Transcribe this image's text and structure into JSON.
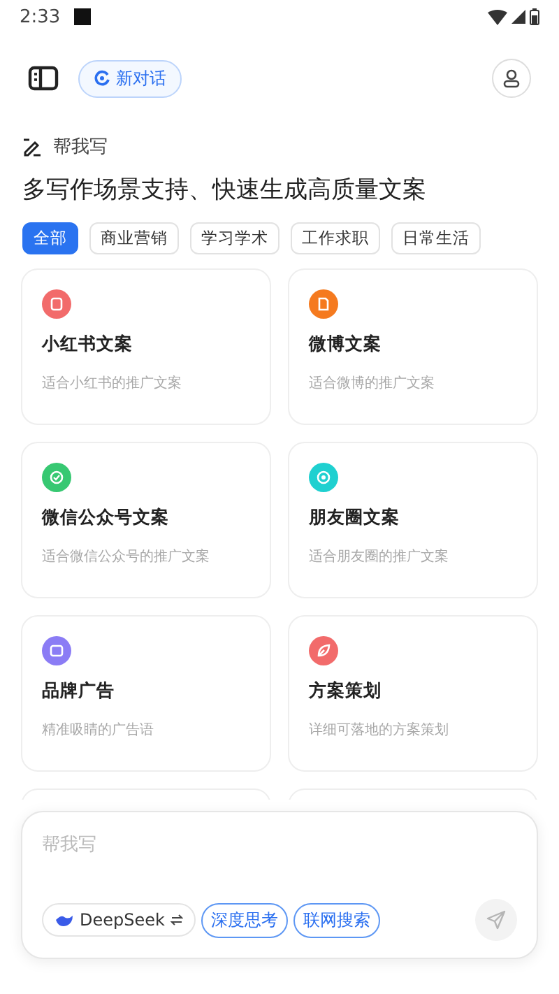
{
  "status_bar": {
    "time": "2:33"
  },
  "header": {
    "new_chat": "新对话"
  },
  "section": {
    "label": "帮我写",
    "headline": "多写作场景支持、快速生成高质量文案"
  },
  "categories": [
    {
      "label": "全部",
      "selected": true
    },
    {
      "label": "商业营销",
      "selected": false
    },
    {
      "label": "学习学术",
      "selected": false
    },
    {
      "label": "工作求职",
      "selected": false
    },
    {
      "label": "日常生活",
      "selected": false
    }
  ],
  "cards": [
    {
      "title": "小红书文案",
      "subtitle": "适合小红书的推广文案",
      "color": "#f26b6b"
    },
    {
      "title": "微博文案",
      "subtitle": "适合微博的推广文案",
      "color": "#f57a1f"
    },
    {
      "title": "微信公众号文案",
      "subtitle": "适合微信公众号的推广文案",
      "color": "#37c872"
    },
    {
      "title": "朋友圈文案",
      "subtitle": "适合朋友圈的推广文案",
      "color": "#1fd0d0"
    },
    {
      "title": "品牌广告",
      "subtitle": "精准吸睛的广告语",
      "color": "#8b7cf5"
    },
    {
      "title": "方案策划",
      "subtitle": "详细可落地的方案策划",
      "color": "#f26b6b"
    }
  ],
  "composer": {
    "placeholder": "帮我写",
    "model": "DeepSeek",
    "toggles": [
      {
        "label": "深度思考",
        "selected": true
      },
      {
        "label": "联网搜索",
        "selected": true
      }
    ]
  }
}
